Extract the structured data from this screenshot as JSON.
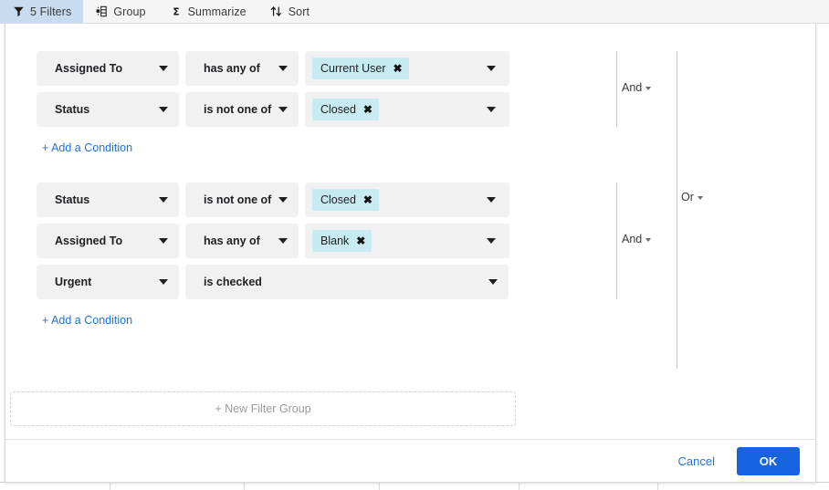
{
  "colors": {
    "accent": "#1764e0",
    "link": "#1a73e8",
    "active_tab_bg": "#c7dcf0",
    "chip_bg": "#c7eaf3",
    "field_bg": "#f1f1f1"
  },
  "tabs": [
    {
      "icon": "funnel-icon",
      "label": "5 Filters",
      "active": true
    },
    {
      "icon": "group-icon",
      "label": "Group",
      "active": false
    },
    {
      "icon": "sigma-icon",
      "label": "Summarize",
      "active": false
    },
    {
      "icon": "sort-icon",
      "label": "Sort",
      "active": false
    }
  ],
  "outer_conjunction": {
    "label": "Or"
  },
  "groups": [
    {
      "conjunction": {
        "label": "And"
      },
      "conditions": [
        {
          "attribute": "Assigned To",
          "operator": "has any of",
          "values": [
            {
              "label": "Current User"
            }
          ],
          "has_value_field": true
        },
        {
          "attribute": "Status",
          "operator": "is not one of",
          "values": [
            {
              "label": "Closed"
            }
          ],
          "has_value_field": true
        }
      ],
      "add_condition_label": "+ Add a Condition"
    },
    {
      "conjunction": {
        "label": "And"
      },
      "conditions": [
        {
          "attribute": "Status",
          "operator": "is not one of",
          "values": [
            {
              "label": "Closed"
            }
          ],
          "has_value_field": true
        },
        {
          "attribute": "Assigned To",
          "operator": "has any of",
          "values": [
            {
              "label": "Blank"
            }
          ],
          "has_value_field": true
        },
        {
          "attribute": "Urgent",
          "operator": "is checked",
          "values": [],
          "has_value_field": false
        }
      ],
      "add_condition_label": "+ Add a Condition"
    }
  ],
  "new_filter_group_label": "+ New Filter Group",
  "footer": {
    "cancel_label": "Cancel",
    "ok_label": "OK"
  },
  "background_table": {
    "column_divider_x": [
      120,
      267,
      415,
      568,
      720
    ]
  }
}
